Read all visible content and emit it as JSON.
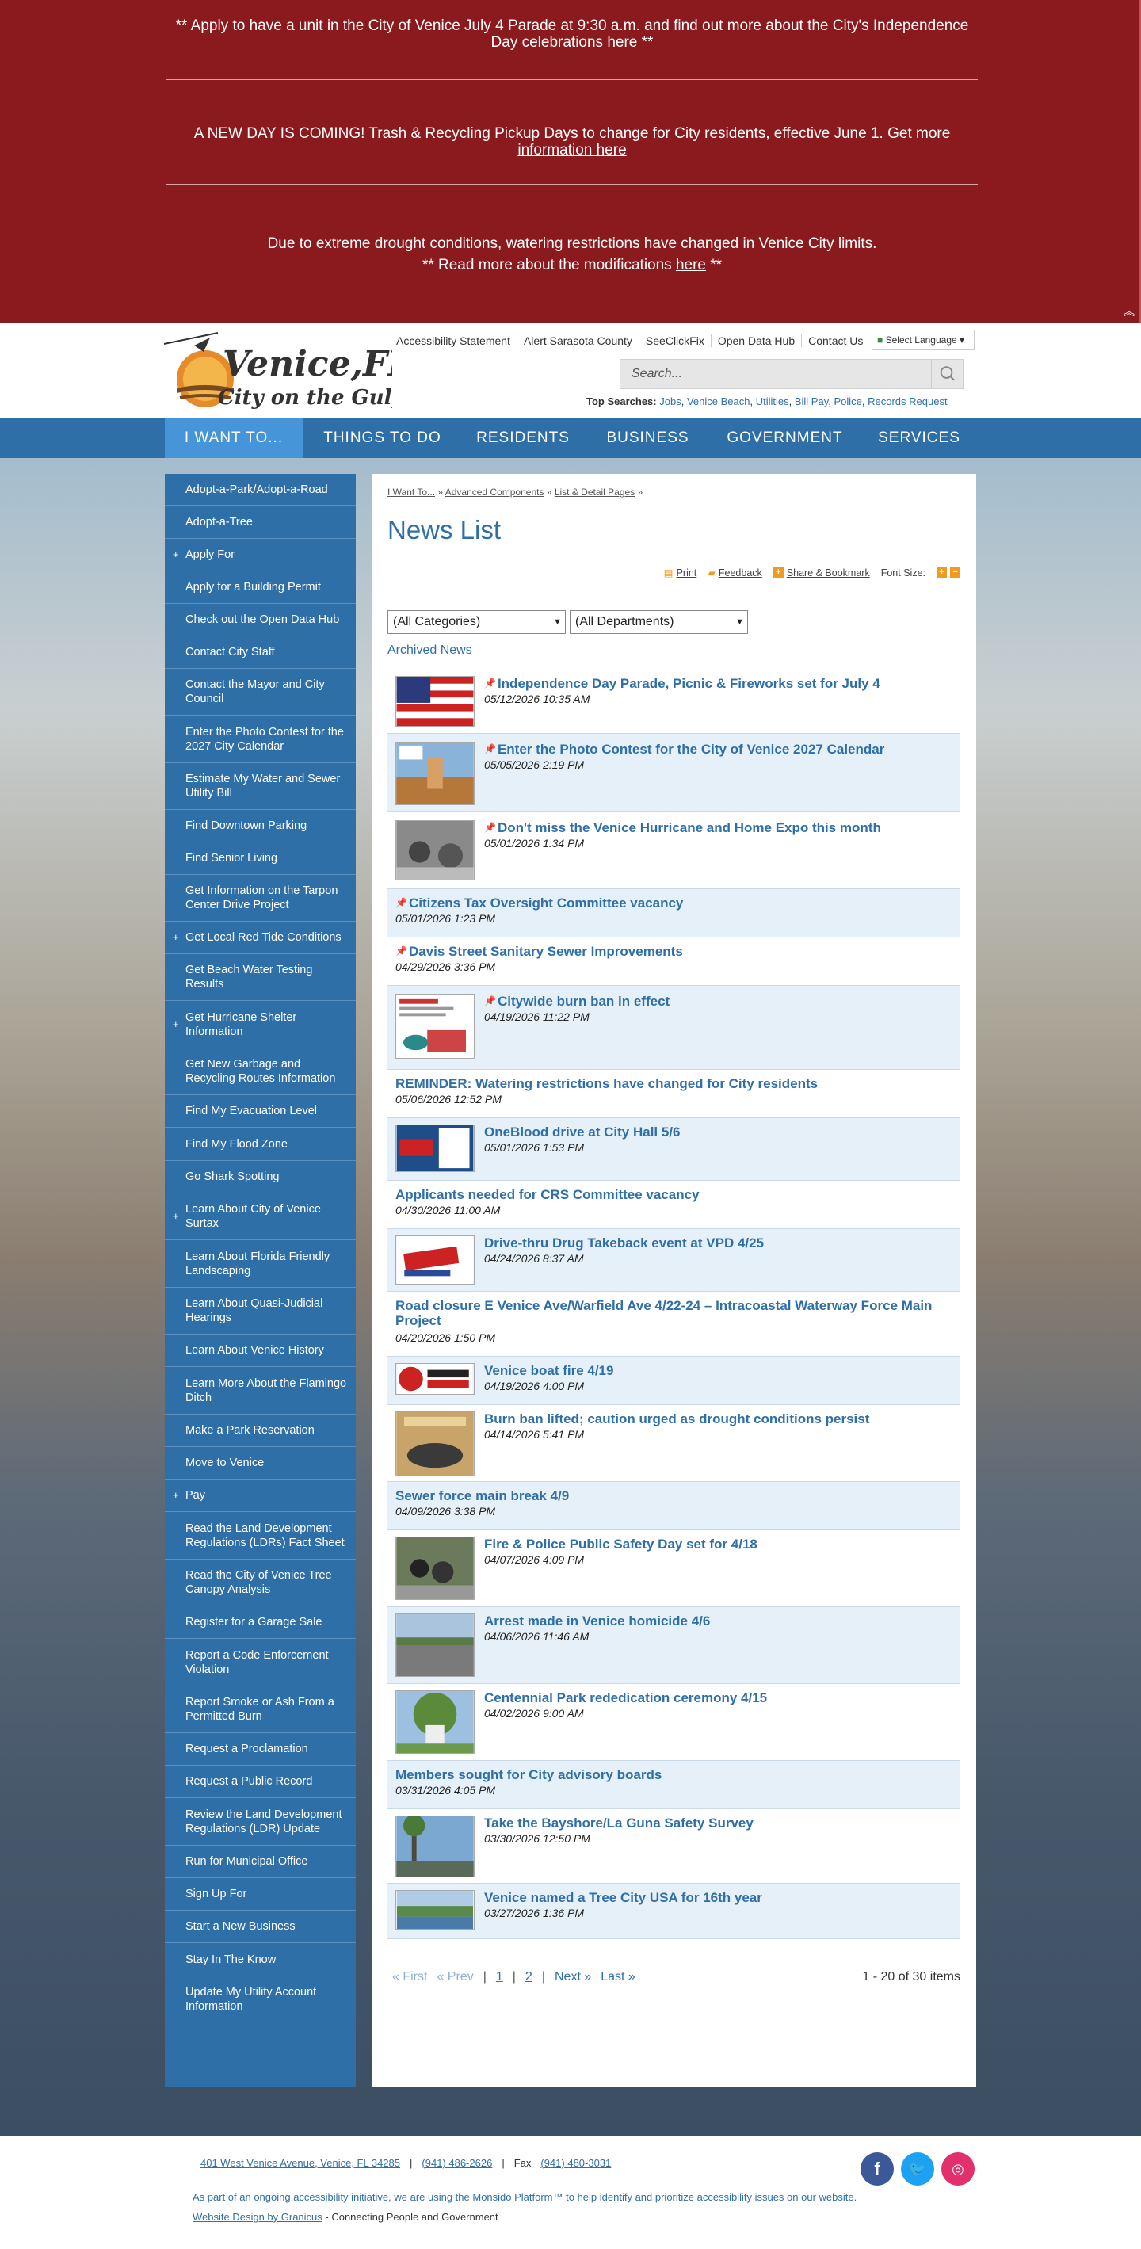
{
  "alerts": {
    "parade_text": "** Apply to have a unit in the City of Venice July 4 Parade at 9:30 a.m. and find out more about the City's Independence Day celebrations",
    "parade_link": "here",
    "parade_end": " **",
    "trash_text": "A NEW DAY IS COMING! Trash & Recycling Pickup Days to change for City residents, effective June 1.",
    "trash_link": "Get more information here",
    "drought_line1": "Due to extreme drought conditions, watering restrictions have changed in Venice City limits.",
    "drought_line2": "** Read more about the modifications",
    "drought_link": "here",
    "drought_end": " **"
  },
  "header": {
    "logo_text": "Venice,FL",
    "logo_tagline": "City on the Gulf",
    "utility_links": [
      "Accessibility Statement",
      "Alert Sarasota County",
      "SeeClickFix",
      "Open Data Hub",
      "Contact Us"
    ],
    "language": "Select Language",
    "search_placeholder": "Search...",
    "top_searches_label": "Top Searches:",
    "top_searches": [
      "Jobs",
      "Venice Beach",
      "Utilities",
      "Bill Pay",
      "Police",
      "Records Request"
    ]
  },
  "nav": [
    "I WANT TO...",
    "THINGS TO DO",
    "RESIDENTS",
    "BUSINESS",
    "GOVERNMENT",
    "SERVICES"
  ],
  "sidebar": [
    "Adopt-a-Park/Adopt-a-Road",
    "Adopt-a-Tree",
    "Apply For",
    "Apply for a Building Permit",
    "Check out the Open Data Hub",
    "Contact City Staff",
    "Contact the Mayor and City Council",
    "Enter the Photo Contest for the 2027 City Calendar",
    "Estimate My Water and Sewer Utility Bill",
    "Find Downtown Parking",
    "Find Senior Living",
    "Get Information on the Tarpon Center Drive Project",
    "Get Local Red Tide Conditions",
    "Get Beach Water Testing Results",
    "Get Hurricane Shelter Information",
    "Get New Garbage and Recycling Routes Information",
    "Find My Evacuation Level",
    "Find My Flood Zone",
    "Go Shark Spotting",
    "Learn About City of Venice Surtax",
    "Learn About Florida Friendly Landscaping",
    "Learn About Quasi-Judicial Hearings",
    "Learn About Venice History",
    "Learn More About the Flamingo Ditch",
    "Make a Park Reservation",
    "Move to Venice",
    "Pay",
    "Read the Land Development Regulations (LDRs) Fact Sheet",
    "Read the City of Venice Tree Canopy Analysis",
    "Register for a Garage Sale",
    "Report a Code Enforcement Violation",
    "Report Smoke or Ash From a Permitted Burn",
    "Request a Proclamation",
    "Request a Public Record",
    "Review the Land Development Regulations (LDR) Update",
    "Run for Municipal Office",
    "Sign Up For",
    "Start a New Business",
    "Stay In The Know",
    "Update My Utility Account Information"
  ],
  "breadcrumb": [
    "I Want To...",
    "Advanced Components",
    "List & Detail Pages"
  ],
  "page_title": "News List",
  "tools": {
    "print": "Print",
    "feedback": "Feedback",
    "share": "Share & Bookmark",
    "font_size": "Font Size:"
  },
  "filters": {
    "categories": "(All Categories)",
    "departments": "(All Departments)"
  },
  "archived": "Archived News",
  "news": [
    {
      "title": "Independence Day Parade, Picnic & Fireworks set for July 4",
      "date": "05/12/2026 10:35 AM",
      "pinned": true
    },
    {
      "title": "Enter the Photo Contest for the City of Venice 2027 Calendar",
      "date": "05/05/2026 2:19 PM",
      "pinned": true
    },
    {
      "title": "Don't miss the Venice Hurricane and Home Expo this month",
      "date": "05/01/2026 1:34 PM",
      "pinned": true
    },
    {
      "title": "Citizens Tax Oversight Committee vacancy",
      "date": "05/01/2026 1:23 PM",
      "pinned": true
    },
    {
      "title": "Davis Street Sanitary Sewer Improvements",
      "date": "04/29/2026 3:36 PM",
      "pinned": true
    },
    {
      "title": "Citywide burn ban in effect",
      "date": "04/19/2026 11:22 PM",
      "pinned": true
    },
    {
      "title": "REMINDER: Watering restrictions have changed for City residents",
      "date": "05/06/2026 12:52 PM",
      "pinned": false
    },
    {
      "title": "OneBlood drive at City Hall 5/6",
      "date": "05/01/2026 1:53 PM",
      "pinned": false
    },
    {
      "title": "Applicants needed for CRS Committee vacancy",
      "date": "04/30/2026 11:00 AM",
      "pinned": false
    },
    {
      "title": "Drive-thru Drug Takeback event at VPD 4/25",
      "date": "04/24/2026 8:37 AM",
      "pinned": false
    },
    {
      "title": "Road closure E Venice Ave/Warfield Ave 4/22-24 – Intracoastal Waterway Force Main Project",
      "date": "04/20/2026 1:50 PM",
      "pinned": false
    },
    {
      "title": "Venice boat fire 4/19",
      "date": "04/19/2026 4:00 PM",
      "pinned": false
    },
    {
      "title": "Burn ban lifted; caution urged as drought conditions persist",
      "date": "04/14/2026 5:41 PM",
      "pinned": false
    },
    {
      "title": "Sewer force main break 4/9",
      "date": "04/09/2026 3:38 PM",
      "pinned": false
    },
    {
      "title": "Fire & Police Public Safety Day set for 4/18",
      "date": "04/07/2026 4:09 PM",
      "pinned": false
    },
    {
      "title": "Arrest made in Venice homicide 4/6",
      "date": "04/06/2026 11:46 AM",
      "pinned": false
    },
    {
      "title": "Centennial Park rededication ceremony 4/15",
      "date": "04/02/2026 9:00 AM",
      "pinned": false
    },
    {
      "title": "Members sought for City advisory boards",
      "date": "03/31/2026 4:05 PM",
      "pinned": false
    },
    {
      "title": "Take the Bayshore/La Guna Safety Survey",
      "date": "03/30/2026 12:50 PM",
      "pinned": false
    },
    {
      "title": "Venice named a Tree City USA for 16th year",
      "date": "03/27/2026 1:36 PM",
      "pinned": false
    }
  ],
  "pager": {
    "first": "« First",
    "prev": "« Prev",
    "p1": "1",
    "p2": "2",
    "next": "Next »",
    "last": "Last »",
    "count": "1 - 20 of 30 items"
  },
  "footer": {
    "address": "401 West Venice Avenue, Venice, FL 34285",
    "phone": "(941) 486-2626",
    "fax_label": "Fax",
    "fax": "(941) 480-3031",
    "accessibility": "As part of an ongoing accessibility initiative, we are using the Monsido Platform™ to help identify and prioritize accessibility issues on our website.",
    "design_link": "Website Design by Granicus",
    "design_tail": " - Connecting People and Government"
  },
  "colors": {
    "alert": "#8b1a1f",
    "nav": "#2f6fa8",
    "accent": "#f29a1f",
    "link": "#2f6fa8"
  }
}
